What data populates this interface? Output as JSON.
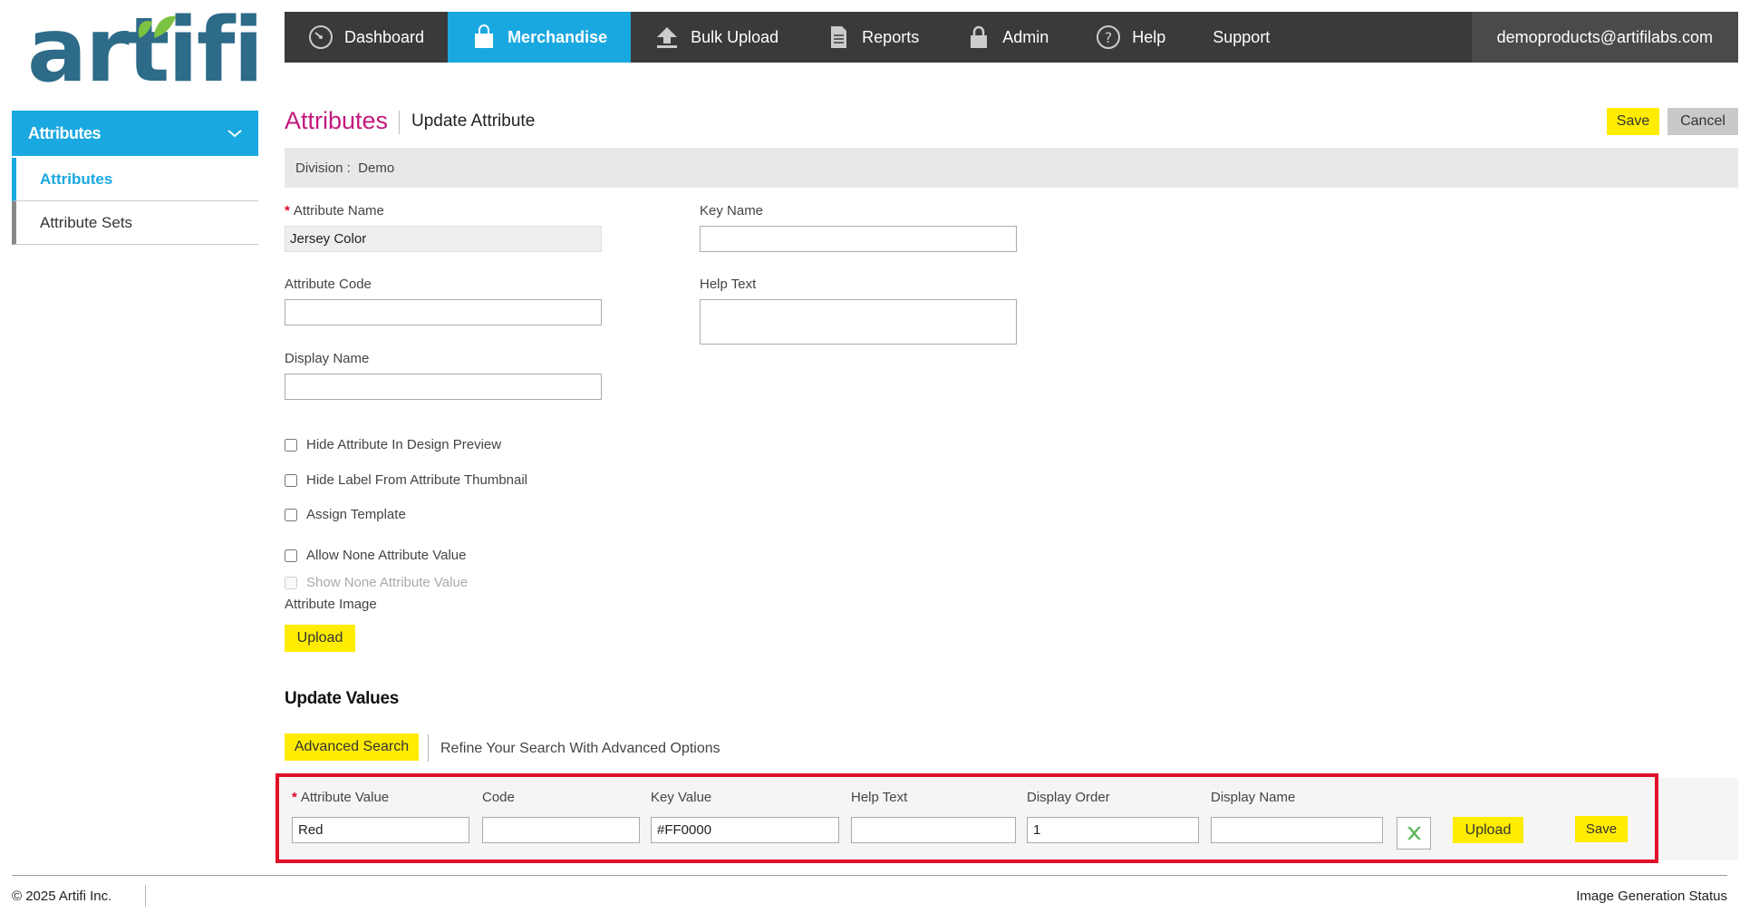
{
  "logo": {
    "text": "artifi"
  },
  "nav": {
    "items": [
      {
        "label": "Dashboard",
        "icon": "dashboard-gauge-icon"
      },
      {
        "label": "Merchandise",
        "icon": "shopping-bag-icon"
      },
      {
        "label": "Bulk Upload",
        "icon": "upload-arrow-icon"
      },
      {
        "label": "Reports",
        "icon": "document-icon"
      },
      {
        "label": "Admin",
        "icon": "lock-icon"
      },
      {
        "label": "Help",
        "icon": "question-circle-icon"
      },
      {
        "label": "Support",
        "icon": ""
      }
    ],
    "user_email": "demoproducts@artifilabs.com"
  },
  "sidebar": {
    "header": "Attributes",
    "items": [
      {
        "label": "Attributes"
      },
      {
        "label": "Attribute Sets"
      }
    ]
  },
  "header": {
    "title": "Attributes",
    "subtitle": "Update Attribute",
    "save_label": "Save",
    "cancel_label": "Cancel"
  },
  "division": {
    "text": "Division :  Demo"
  },
  "form": {
    "attribute_name_label": "Attribute Name",
    "attribute_name_value": "Jersey Color",
    "key_name_label": "Key Name",
    "key_name_value": "",
    "attribute_code_label": "Attribute Code",
    "attribute_code_value": "",
    "help_text_label": "Help Text",
    "help_text_value": "",
    "display_name_label": "Display Name",
    "display_name_value": "",
    "checkboxes": [
      {
        "label": "Hide Attribute In Design Preview",
        "checked": false
      },
      {
        "label": "Hide Label From Attribute Thumbnail",
        "checked": false
      },
      {
        "label": "Assign Template",
        "checked": false
      },
      {
        "label": "Allow None Attribute Value",
        "checked": false
      },
      {
        "label": "Show None Attribute Value",
        "checked": false,
        "disabled": true
      }
    ],
    "attribute_image_label": "Attribute Image",
    "upload_label": "Upload"
  },
  "values": {
    "section_title": "Update Values",
    "advanced_search_label": "Advanced Search",
    "advanced_search_hint": "Refine Your Search With Advanced Options",
    "columns": {
      "attribute_value": "Attribute Value",
      "code": "Code",
      "key_value": "Key Value",
      "help_text": "Help Text",
      "display_order": "Display Order",
      "display_name": "Display Name"
    },
    "row": {
      "attribute_value": "Red",
      "code": "",
      "key_value": "#FF0000",
      "help_text": "",
      "display_order": "1",
      "display_name": ""
    },
    "upload_label": "Upload",
    "save_label": "Save"
  },
  "footer": {
    "copyright": "© 2025 Artifi Inc.",
    "status_link": "Image Generation Status"
  },
  "colors": {
    "nav_bg": "#3a3a3a",
    "accent_blue": "#1aa8e0",
    "title_magenta": "#c5197d",
    "button_yellow": "#ffec00",
    "highlight_red": "#e0102a"
  }
}
